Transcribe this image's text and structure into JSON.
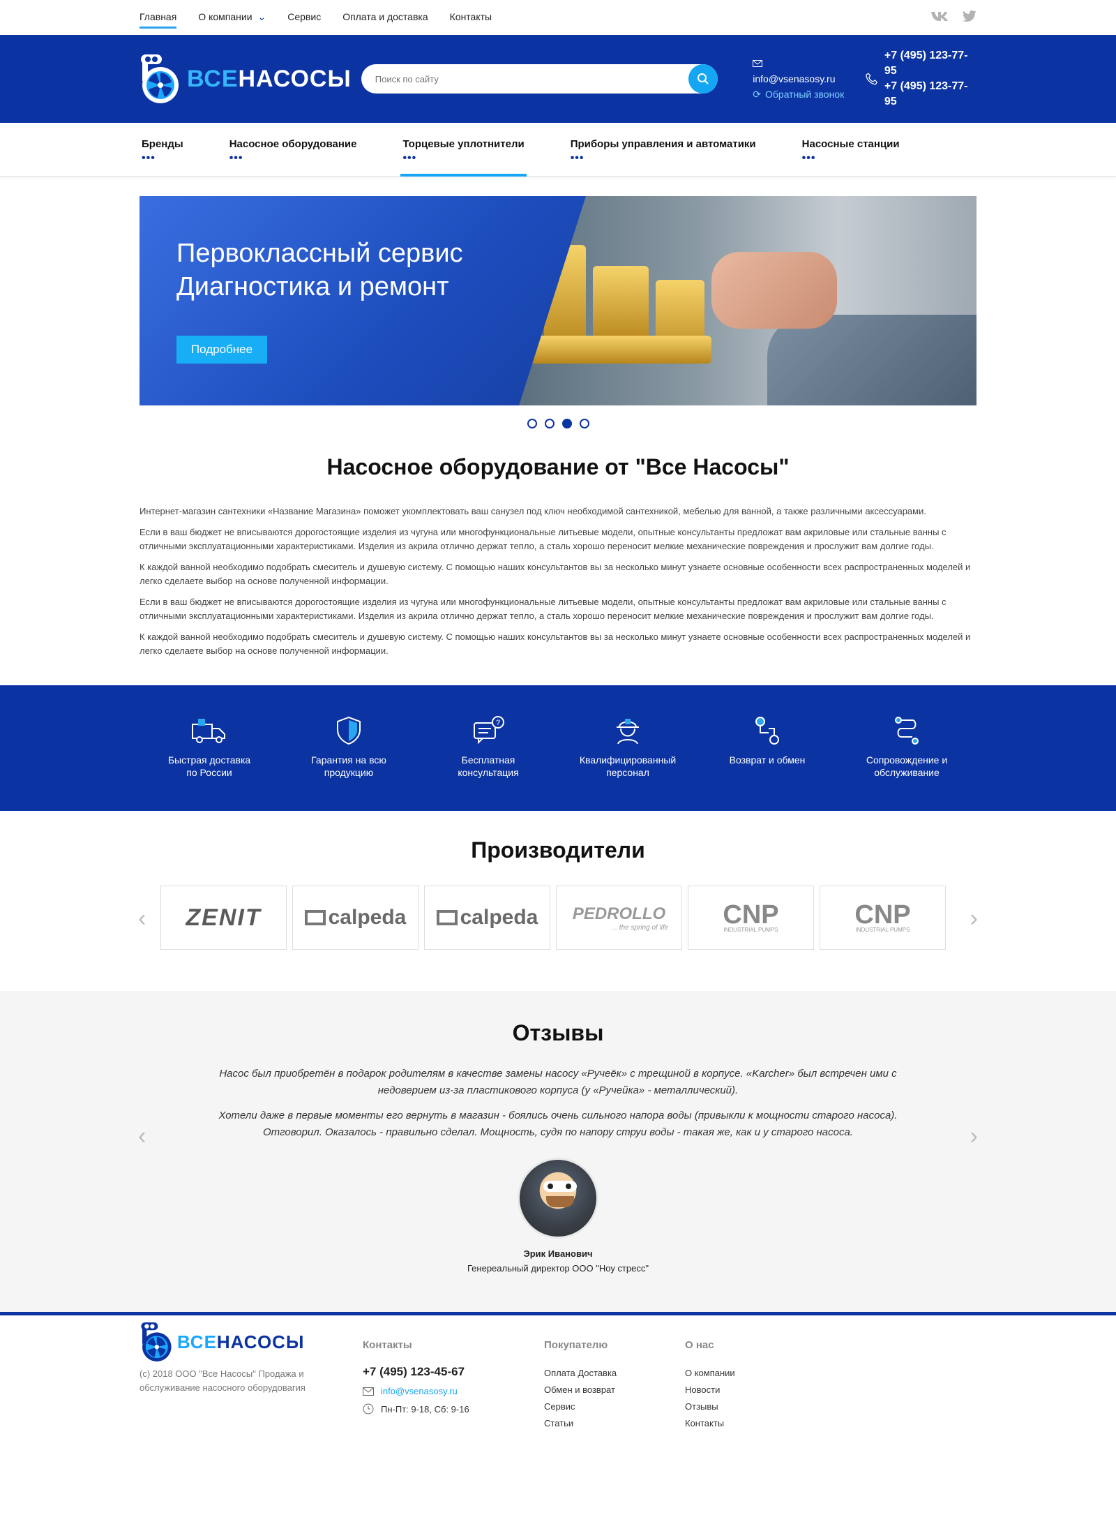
{
  "topnav": {
    "items": [
      "Главная",
      "О компании",
      "Сервис",
      "Оплата и доставка",
      "Контакты"
    ],
    "social": [
      "vk-icon",
      "twitter-icon"
    ]
  },
  "header": {
    "logo_prefix": "ВСЕ",
    "logo_suffix": "НАСОСЫ",
    "search_placeholder": "Поиск по сайту",
    "email": "info@vsenasosy.ru",
    "callback": "Обратный звонок",
    "phone1": "+7 (495) 123-77-95",
    "phone2": "+7 (495) 123-77-95"
  },
  "catnav": [
    "Бренды",
    "Насосное оборудование",
    "Торцевые уплотнители",
    "Приборы управления и автоматики",
    "Насосные станции"
  ],
  "hero": {
    "line1": "Первоклассный сервис",
    "line2": "Диагностика и ремонт",
    "button": "Подробнее",
    "active_slide": 3,
    "slides": 4
  },
  "intro": {
    "title": "Насосное оборудование от \"Все Насосы\"",
    "paragraphs": [
      "Интернет-магазин сантехники «Название Магазина» поможет укомплектовать ваш санузел под ключ необходимой сантехникой, мебелью для ванной, а также различными аксессуарами.",
      "Если в ваш бюджет не вписываются дорогостоящие изделия из чугуна или многофункциональные литьевые модели, опытные консультанты предложат вам акриловые или стальные ванны с отличными эксплуатационными характеристиками. Изделия из акрила отлично держат тепло, а сталь хорошо переносит мелкие механические повреждения и прослужит вам долгие годы.",
      "К каждой ванной необходимо подобрать смеситель и душевую систему. С помощью наших консультантов вы за несколько минут узнаете основные особенности всех распространенных моделей и легко сделаете выбор на основе полученной информации.",
      "Если в ваш бюджет не вписываются дорогостоящие изделия из чугуна или многофункциональные литьевые модели, опытные консультанты предложат вам акриловые или стальные ванны с отличными эксплуатационными характеристиками. Изделия из акрила отлично держат тепло, а сталь хорошо переносит мелкие механические повреждения и прослужит вам долгие годы.",
      "К каждой ванной необходимо подобрать смеситель и душевую систему. С помощью наших консультантов вы за несколько минут узнаете основные особенности всех распространенных моделей и легко сделаете выбор на основе полученной информации."
    ]
  },
  "features": [
    {
      "line1": "Быстрая доставка",
      "line2": "по России",
      "icon": "truck-icon"
    },
    {
      "line1": "Гарантия на всю",
      "line2": "продукцию",
      "icon": "shield-icon"
    },
    {
      "line1": "Бесплатная",
      "line2": "консультация",
      "icon": "chat-icon"
    },
    {
      "line1": "Квалифицированный",
      "line2": "персонал",
      "icon": "worker-icon"
    },
    {
      "line1": "Возврат и обмен",
      "line2": "",
      "icon": "return-icon"
    },
    {
      "line1": "Сопровождение и",
      "line2": "обслуживание",
      "icon": "route-icon"
    }
  ],
  "producers": {
    "title": "Производители",
    "brands": [
      "ZENIT",
      "calpeda",
      "calpeda",
      "PEDROLLO",
      "CNP",
      "CNP"
    ],
    "pedrollo_tagline": "... the spring of life",
    "cnp_tagline": "INDUSTRIAL PUMPS"
  },
  "reviews": {
    "title": "Отзывы",
    "p1": "Насос был приобретён в подарок родителям в качестве замены насосу «Ручеёк» с трещиной в корпусе. «Karcher» был встречен ими с недоверием из-за пластикового корпуса (у «Ручейка» - металлический).",
    "p2": "Хотели даже в первые моменты его вернуть в магазин - боялись очень сильного напора воды (привыкли к мощности старого насоса). Отговорил. Оказалось - правильно сделал. Мощность, судя по напору струи воды - такая же, как и у старого насоса.",
    "name": "Эрик Иванович",
    "position": "Генереальный директор ООО  \"Ноу стресс\""
  },
  "footer": {
    "copy": "(c) 2018 ООО \"Все Насосы\" Продажа и обслуживание насосного оборудовагия",
    "contacts_head": "Контакты",
    "phone": "+7 (495) 123-45-67",
    "email": "info@vsenasosy.ru",
    "hours": "Пн-Пт: 9-18, Сб: 9-16",
    "buyer_head": "Покупателю",
    "buyer_items": [
      "Оплата Доставка",
      "Обмен и возврат",
      "Сервис",
      "Статьи"
    ],
    "about_head": "О нас",
    "about_items": [
      "О компании",
      "Новости",
      "Отзывы",
      "Контакты"
    ]
  },
  "colors": {
    "brand": "#0b33a1",
    "accent": "#14a6f2"
  }
}
